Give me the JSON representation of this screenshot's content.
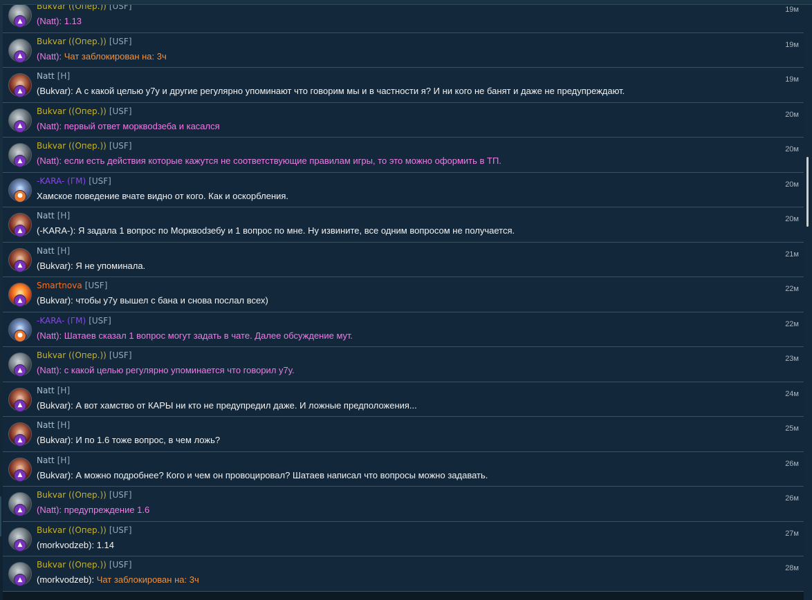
{
  "theme": {
    "background": "#0d1a23",
    "panel": "#13283a",
    "row_alt": "#12273a",
    "separator": "#3b5262",
    "message_text": "#f2f2f2",
    "timestamp": "#a8b5bf",
    "tag": "#94a9b8"
  },
  "badge_icons": {
    "purple": "▲",
    "orange": "●"
  },
  "messages": [
    {
      "avatar": "robot",
      "badge": "purple",
      "name": "Bukvar ((Опер.))",
      "name_color": "#c7b32c",
      "tag": "[USF]",
      "time": "19м",
      "prefix": "(Natt): ",
      "text": "1.13",
      "prefix_color": "#ef7ae7",
      "text_color": "#ef7ae7"
    },
    {
      "avatar": "robot",
      "badge": "purple",
      "name": "Bukvar ((Опер.))",
      "name_color": "#c7b32c",
      "tag": "[USF]",
      "time": "19м",
      "prefix": "(Natt): ",
      "text": "Чат заблокирован на: 3ч",
      "prefix_color": "#ef7ae7",
      "text_color": "#f0913b"
    },
    {
      "avatar": "girl",
      "badge": "purple",
      "name": "Natt",
      "name_color": "#a6c1d3",
      "tag": "[H]",
      "time": "19м",
      "prefix": "(Bukvar): ",
      "text": "А с какой целью у7у и другие регулярно упоминают что говорим мы и в частности я? И ни кого не банят и даже не предупреждают.",
      "prefix_color": "#f2f2f2",
      "text_color": "#f2f2f2"
    },
    {
      "avatar": "robot",
      "badge": "purple",
      "name": "Bukvar ((Опер.))",
      "name_color": "#c7b32c",
      "tag": "[USF]",
      "time": "20м",
      "prefix": "(Natt): ",
      "text": "первый ответ морквodзеба и касался",
      "prefix_color": "#ef7ae7",
      "text_color": "#ef7ae7"
    },
    {
      "avatar": "robot",
      "badge": "purple",
      "name": "Bukvar ((Опер.))",
      "name_color": "#c7b32c",
      "tag": "[USF]",
      "time": "20м",
      "prefix": "(Natt): ",
      "text": "если есть действия которые кажутся не соответствующие правилам игры, то это можно оформить в ТП.",
      "prefix_color": "#ef7ae7",
      "text_color": "#ef7ae7"
    },
    {
      "avatar": "karakter",
      "badge": "orange",
      "name": "-KARA- (ГМ)",
      "name_color": "#8d42f0",
      "tag": "[USF]",
      "time": "20м",
      "prefix": "",
      "text": "Хамское поведение вчате видно от кого. Как и оскорбления.",
      "prefix_color": "#f2f2f2",
      "text_color": "#f2f2f2"
    },
    {
      "avatar": "girl",
      "badge": "purple",
      "name": "Natt",
      "name_color": "#a6c1d3",
      "tag": "[H]",
      "time": "20м",
      "prefix": "(-KARA-): ",
      "text": "Я задала 1 вопрос по Морквodзебу и 1 вопрос по мне. Ну извините, все одним вопросом не получается.",
      "prefix_color": "#f2f2f2",
      "text_color": "#f2f2f2"
    },
    {
      "avatar": "girl",
      "badge": "purple",
      "name": "Natt",
      "name_color": "#a6c1d3",
      "tag": "[H]",
      "time": "21м",
      "prefix": "(Bukvar): ",
      "text": "Я не упоминала.",
      "prefix_color": "#f2f2f2",
      "text_color": "#f2f2f2"
    },
    {
      "avatar": "smart",
      "badge": "purple",
      "name": "Smartnova",
      "name_color": "#f0742a",
      "tag": "[USF]",
      "time": "22м",
      "prefix": "(Bukvar): ",
      "text": "чтобы у7у вышел с бана и снова послал всех)",
      "prefix_color": "#f2f2f2",
      "text_color": "#f2f2f2"
    },
    {
      "avatar": "karakter",
      "badge": "orange",
      "name": "-KARA- (ГМ)",
      "name_color": "#8d42f0",
      "tag": "[USF]",
      "time": "22м",
      "prefix": "(Natt): ",
      "text": "Шатаев сказал 1 вопрос могут задать в чате. Далее обсуждение мут.",
      "prefix_color": "#ef7ae7",
      "text_color": "#ef7ae7"
    },
    {
      "avatar": "robot",
      "badge": "purple",
      "name": "Bukvar ((Опер.))",
      "name_color": "#c7b32c",
      "tag": "[USF]",
      "time": "23м",
      "prefix": "(Natt): ",
      "text": "с какой целью регулярно упоминается что говорил у7у.",
      "prefix_color": "#ef7ae7",
      "text_color": "#ef7ae7"
    },
    {
      "avatar": "girl",
      "badge": "purple",
      "name": "Natt",
      "name_color": "#a6c1d3",
      "tag": "[H]",
      "time": "24м",
      "prefix": "(Bukvar): ",
      "text": "А вот хамство от КАРЫ ни кто не предупредил даже. И ложные предположения...",
      "prefix_color": "#f2f2f2",
      "text_color": "#f2f2f2"
    },
    {
      "avatar": "girl",
      "badge": "purple",
      "name": "Natt",
      "name_color": "#a6c1d3",
      "tag": "[H]",
      "time": "25м",
      "prefix": "(Bukvar): ",
      "text": "И по 1.6 тоже вопрос, в чем ложь?",
      "prefix_color": "#f2f2f2",
      "text_color": "#f2f2f2"
    },
    {
      "avatar": "girl",
      "badge": "purple",
      "name": "Natt",
      "name_color": "#a6c1d3",
      "tag": "[H]",
      "time": "26м",
      "prefix": "(Bukvar): ",
      "text": "А можно подробнее? Кого и чем он провоцировал? Шатаев написал что вопросы можно задавать.",
      "prefix_color": "#f2f2f2",
      "text_color": "#f2f2f2"
    },
    {
      "avatar": "robot",
      "badge": "purple",
      "name": "Bukvar ((Опер.))",
      "name_color": "#c7b32c",
      "tag": "[USF]",
      "time": "26м",
      "prefix": "(Natt): ",
      "text": "предупреждение 1.6",
      "prefix_color": "#ef7ae7",
      "text_color": "#ef7ae7"
    },
    {
      "avatar": "robot",
      "badge": "purple",
      "name": "Bukvar ((Опер.))",
      "name_color": "#c7b32c",
      "tag": "[USF]",
      "time": "27м",
      "prefix": "(morkvodzeb): ",
      "text": "1.14",
      "prefix_color": "#f2f2f2",
      "text_color": "#f2f2f2"
    },
    {
      "avatar": "robot",
      "badge": "purple",
      "name": "Bukvar ((Опер.))",
      "name_color": "#c7b32c",
      "tag": "[USF]",
      "time": "28м",
      "prefix": "(morkvodzeb): ",
      "text": "Чат заблокирован на: 3ч",
      "prefix_color": "#f2f2f2",
      "text_color": "#f0913b"
    }
  ]
}
